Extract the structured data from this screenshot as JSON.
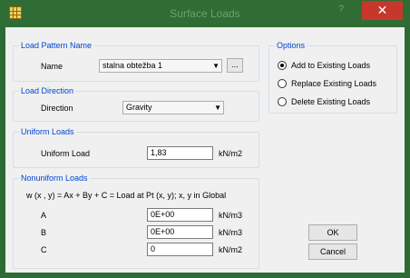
{
  "window": {
    "title": "Surface Loads",
    "help": "?",
    "close": "✕"
  },
  "pattern": {
    "legend": "Load Pattern Name",
    "name_label": "Name",
    "value": "stalna obtežba 1",
    "more": "..."
  },
  "direction": {
    "legend": "Load Direction",
    "label": "Direction",
    "value": "Gravity"
  },
  "uniform": {
    "legend": "Uniform Loads",
    "label": "Uniform Load",
    "value": "1,83",
    "unit": "kN/m2"
  },
  "nonuniform": {
    "legend": "Nonuniform Loads",
    "formula": "w (x , y)  =  Ax + By + C  =  Load at Pt (x, y);  x, y in Global",
    "rows": [
      {
        "label": "A",
        "value": "0E+00",
        "unit": "kN/m3"
      },
      {
        "label": "B",
        "value": "0E+00",
        "unit": "kN/m3"
      },
      {
        "label": "C",
        "value": "0",
        "unit": "kN/m2"
      }
    ]
  },
  "options": {
    "legend": "Options",
    "items": [
      {
        "label": "Add to Existing Loads",
        "selected": true
      },
      {
        "label": "Replace Existing Loads",
        "selected": false
      },
      {
        "label": "Delete Existing Loads",
        "selected": false
      }
    ]
  },
  "buttons": {
    "ok": "OK",
    "cancel": "Cancel"
  }
}
